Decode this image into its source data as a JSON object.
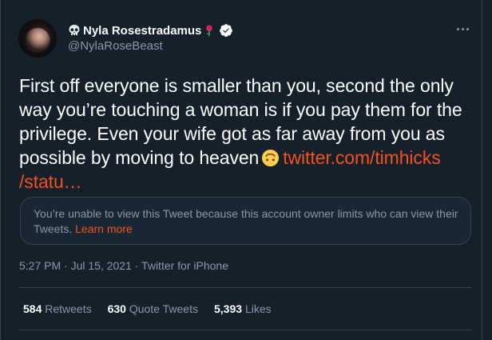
{
  "tweet": {
    "author": {
      "display_name": "Nyla Rosestradamus",
      "handle": "@NylaRoseBeast",
      "verified": true
    },
    "text_before_emoji": "First off everyone is smaller than you, second the only way you’re touching a woman is if you pay them for the privilege. Even your wife got as far away from you as possible by moving to heaven",
    "emoji": "upside-down-face",
    "link_text_line1": "twitter.com/timhicks",
    "link_text_line2": "/statu…",
    "notice": {
      "text": "You’re unable to view this Tweet because this account owner limits who can view their Tweets.",
      "link_label": "Learn more"
    },
    "timestamp": "5:27 PM · Jul 15, 2021 · Twitter for iPhone",
    "stats": {
      "retweets": {
        "count": "584",
        "label": "Retweets"
      },
      "quote_tweets": {
        "count": "630",
        "label": "Quote Tweets"
      },
      "likes": {
        "count": "5,393",
        "label": "Likes"
      }
    }
  },
  "colors": {
    "background": "#15202b",
    "accent": "#f4511e",
    "secondary_text": "#8899a6",
    "border": "#38444d"
  },
  "icons": {
    "skull": "skull-icon",
    "rose": "rose-icon",
    "verified": "verified-badge-icon",
    "more": "more-options-icon"
  }
}
